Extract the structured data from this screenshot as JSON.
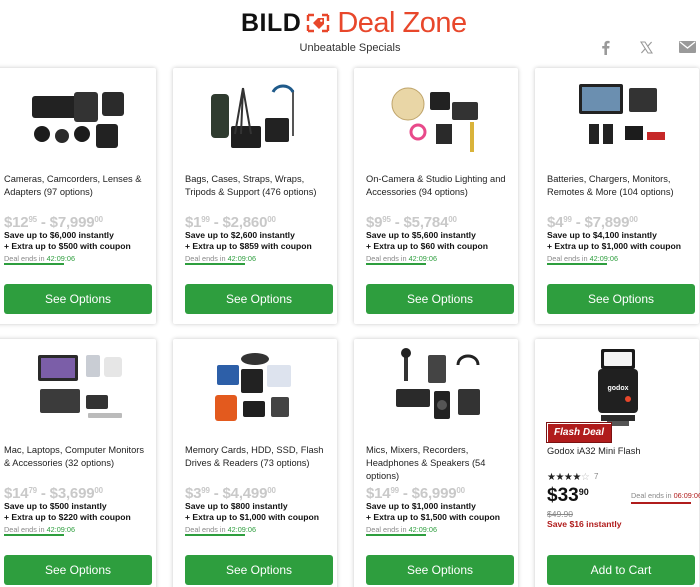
{
  "header": {
    "logo_bild": "BILD",
    "logo_deal": "Deal Zone",
    "tagline": "Unbeatable Specials"
  },
  "social": {
    "facebook_icon": "facebook-icon",
    "x_icon": "x-icon",
    "mail_icon": "mail-icon"
  },
  "colors": {
    "accent_green": "#2e9e3e",
    "flash_red": "#b01c1c",
    "brand_orange": "#e8472b"
  },
  "cards": [
    {
      "title": "Cameras, Camcorders, Lenses & Adapters (97 options)",
      "price_low": "$12",
      "price_low_cents": "95",
      "price_high": "$7,999",
      "price_high_cents": "00",
      "save_line1": "Save up to $6,000 instantly",
      "save_line2": "+ Extra up to $500 with coupon",
      "ends_label": "Deal ends in",
      "ends_time": "42:09:06",
      "progress": 1.0,
      "button": "See Options"
    },
    {
      "title": "Bags, Cases, Straps, Wraps, Tripods & Support (476 options)",
      "price_low": "$1",
      "price_low_cents": "99",
      "price_high": "$2,860",
      "price_high_cents": "00",
      "save_line1": "Save up to $2,600 instantly",
      "save_line2": "+ Extra up to $859 with coupon",
      "ends_label": "Deal ends in",
      "ends_time": "42:09:06",
      "progress": 1.0,
      "button": "See Options"
    },
    {
      "title": "On-Camera & Studio Lighting and Accessories (94 options)",
      "price_low": "$9",
      "price_low_cents": "95",
      "price_high": "$5,784",
      "price_high_cents": "00",
      "save_line1": "Save up to $5,600 instantly",
      "save_line2": "+ Extra up to $60 with coupon",
      "ends_label": "Deal ends in",
      "ends_time": "42:09:06",
      "progress": 1.0,
      "button": "See Options"
    },
    {
      "title": "Batteries, Chargers, Monitors, Remotes & More (104 options)",
      "price_low": "$4",
      "price_low_cents": "99",
      "price_high": "$7,899",
      "price_high_cents": "00",
      "save_line1": "Save up to $4,100 instantly",
      "save_line2": "+ Extra up to $1,000 with coupon",
      "ends_label": "Deal ends in",
      "ends_time": "42:09:06",
      "progress": 1.0,
      "button": "See Options"
    },
    {
      "title": "Mac, Laptops, Computer Monitors & Accessories (32 options)",
      "price_low": "$14",
      "price_low_cents": "79",
      "price_high": "$3,699",
      "price_high_cents": "00",
      "save_line1": "Save up to $500 instantly",
      "save_line2": "+ Extra up to $220 with coupon",
      "ends_label": "Deal ends in",
      "ends_time": "42:09:06",
      "progress": 1.0,
      "button": "See Options"
    },
    {
      "title": "Memory Cards, HDD, SSD, Flash Drives & Readers (73 options)",
      "price_low": "$3",
      "price_low_cents": "99",
      "price_high": "$4,499",
      "price_high_cents": "00",
      "save_line1": "Save up to $800 instantly",
      "save_line2": "+ Extra up to $1,000 with coupon",
      "ends_label": "Deal ends in",
      "ends_time": "42:09:06",
      "progress": 1.0,
      "button": "See Options"
    },
    {
      "title": "Mics, Mixers, Recorders, Headphones & Speakers (54 options)",
      "price_low": "$14",
      "price_low_cents": "99",
      "price_high": "$6,999",
      "price_high_cents": "00",
      "save_line1": "Save up to $1,000 instantly",
      "save_line2": "+ Extra up to $1,500 with coupon",
      "ends_label": "Deal ends in",
      "ends_time": "42:09:06",
      "progress": 1.0,
      "button": "See Options"
    }
  ],
  "flash": {
    "badge": "Flash Deal",
    "title": "Godox iA32 Mini Flash",
    "rating": 4,
    "review_count": "7",
    "price": "$33",
    "price_cents": "90",
    "old_price": "$49.90",
    "save": "Save $16 instantly",
    "ends_label": "Deal ends in",
    "ends_time": "06:09:06",
    "progress": 1.0,
    "button": "Add to Cart",
    "flash_label": "godox"
  }
}
